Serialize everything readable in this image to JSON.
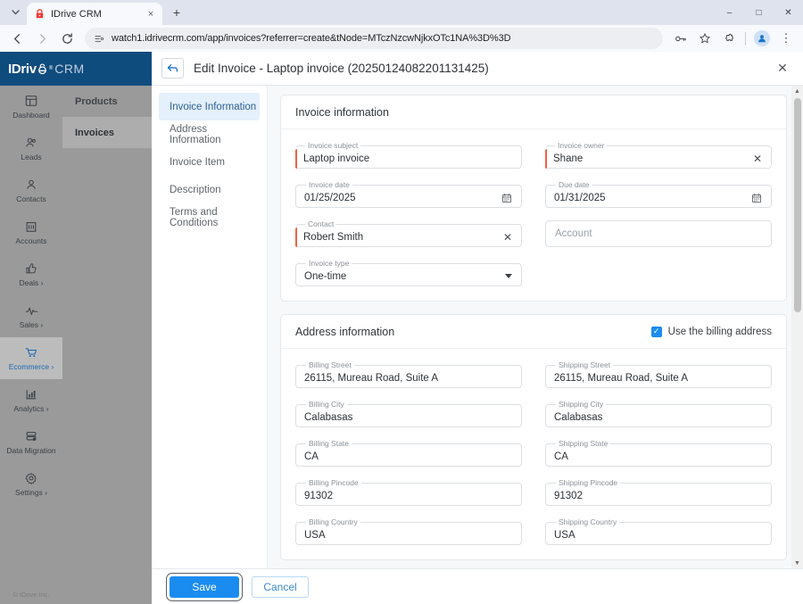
{
  "browser": {
    "tab": {
      "title": "IDrive CRM",
      "favicon_icon": "idrive-lock-icon",
      "close_icon": "×"
    },
    "tab_list_icon": "chevron-down-icon",
    "new_tab_icon": "+",
    "window_controls": {
      "minimize": "–",
      "maximize": "□",
      "close": "✕"
    },
    "nav": {
      "back_icon": "←",
      "forward_icon": "→",
      "reload_icon": "⟳"
    },
    "omnibox": {
      "site_info_icon": "page-info-icon",
      "url": "watch1.idrivecrm.com/app/invoices?referrer=create&tNode=MTczNzcwNjkxOTc1NA%3D%3D"
    },
    "actions": {
      "password_icon": "key-icon",
      "bookmark_icon": "☆",
      "extensions_icon": "puzzle-icon",
      "profile_icon": "avatar-icon",
      "menu_icon": "⋮"
    }
  },
  "app": {
    "brand": {
      "name": "IDriv",
      "e": "e",
      "reg": "®",
      "suffix": "CRM"
    },
    "rail": [
      {
        "label": "Dashboard",
        "icon": "dashboard-icon",
        "active": false,
        "arrow": ""
      },
      {
        "label": "Leads",
        "icon": "leads-icon",
        "active": false,
        "arrow": ""
      },
      {
        "label": "Contacts",
        "icon": "contact-icon",
        "active": false,
        "arrow": ""
      },
      {
        "label": "Accounts",
        "icon": "building-icon",
        "active": false,
        "arrow": ""
      },
      {
        "label": "Deals",
        "icon": "thumbs-up-icon",
        "active": false,
        "arrow": "›"
      },
      {
        "label": "Sales",
        "icon": "pulse-icon",
        "active": false,
        "arrow": "›"
      },
      {
        "label": "Ecommerce",
        "icon": "cart-icon",
        "active": true,
        "arrow": "›"
      },
      {
        "label": "Analytics",
        "icon": "bar-chart-icon",
        "active": false,
        "arrow": "›"
      },
      {
        "label": "Data Migration",
        "icon": "database-icon",
        "active": false,
        "arrow": ""
      },
      {
        "label": "Settings",
        "icon": "gear-icon",
        "active": false,
        "arrow": "›"
      }
    ],
    "footer": "© IDrive Inc.",
    "submenu": [
      {
        "label": "Products",
        "active": false
      },
      {
        "label": "Invoices",
        "active": true
      }
    ],
    "accent_blue": "#1a8cf0",
    "brand_blue": "#0f4c7e",
    "required_marker_color": "#f4603e"
  },
  "modal": {
    "back_icon": "←",
    "title": "Edit Invoice - Laptop invoice (20250124082201131425)",
    "close_icon": "✕",
    "nav": [
      {
        "label": "Invoice Information",
        "active": true
      },
      {
        "label": "Address Information",
        "active": false
      },
      {
        "label": "Invoice Item",
        "active": false
      },
      {
        "label": "Description",
        "active": false
      },
      {
        "label": "Terms and Conditions",
        "active": false
      }
    ],
    "invoice_card": {
      "title": "Invoice information",
      "fields": [
        {
          "label": "Invoice subject",
          "value": "Laptop invoice",
          "required": true,
          "icon": ""
        },
        {
          "label": "Invoice owner",
          "value": "Shane",
          "required": true,
          "icon": "clear-icon",
          "icon_glyph": "✕"
        },
        {
          "label": "Invoice date",
          "value": "01/25/2025",
          "required": false,
          "icon": "calendar-icon",
          "icon_glyph": "▦"
        },
        {
          "label": "Due date",
          "value": "01/31/2025",
          "required": false,
          "icon": "calendar-icon",
          "icon_glyph": "▦"
        },
        {
          "label": "Contact",
          "value": "Robert Smith",
          "required": true,
          "icon": "clear-icon",
          "icon_glyph": "✕"
        }
      ],
      "account": {
        "placeholder": "Account",
        "value": ""
      },
      "invoice_type": {
        "label": "Invoice type",
        "value": "One-time",
        "icon": "chevron-down-icon"
      }
    },
    "address_card": {
      "title": "Address information",
      "checkbox": {
        "label": "Use the billing address",
        "checked": true,
        "glyph": "✓"
      },
      "rows": [
        {
          "billing_label": "Billing Street",
          "billing_value": "26115, Mureau Road, Suite A",
          "shipping_label": "Shipping Street",
          "shipping_value": "26115, Mureau Road, Suite A"
        },
        {
          "billing_label": "Billing City",
          "billing_value": "Calabasas",
          "shipping_label": "Shipping City",
          "shipping_value": "Calabasas"
        },
        {
          "billing_label": "Billing State",
          "billing_value": "CA",
          "shipping_label": "Shipping State",
          "shipping_value": "CA"
        },
        {
          "billing_label": "Billing Pincode",
          "billing_value": "91302",
          "shipping_label": "Shipping Pincode",
          "shipping_value": "91302"
        },
        {
          "billing_label": "Billing Country",
          "billing_value": "USA",
          "shipping_label": "Shipping Country",
          "shipping_value": "USA"
        }
      ]
    },
    "footer": {
      "save_label": "Save",
      "cancel_label": "Cancel"
    },
    "scrollbar": {
      "up_icon": "▲",
      "down_icon": "▼"
    }
  }
}
